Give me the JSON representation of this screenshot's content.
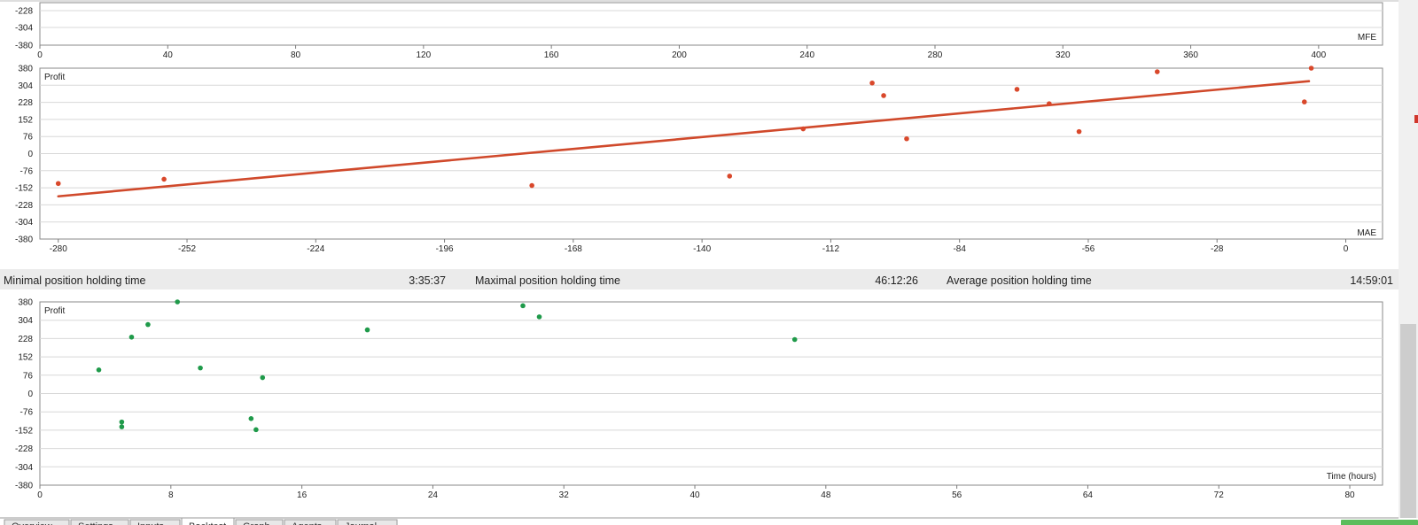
{
  "colors": {
    "mae_series": "#d9482b",
    "trend_line": "#d0492b",
    "time_series": "#1f9a4a",
    "grid": "#d8d8d8",
    "axis": "#7a7a7a",
    "stats_bar": "#ebebeb",
    "tab_active": "#ffffff",
    "tab_inactive": "#e8e8e8",
    "status_button": "#5cbd5c",
    "scroll_marker": "#d0362b"
  },
  "chart_data": [
    {
      "id": "mfe",
      "type": "scatter",
      "title": "",
      "ylabel": "",
      "xlabel": "MFE",
      "xlim": [
        0,
        420
      ],
      "x_ticks": [
        0,
        40,
        80,
        120,
        160,
        200,
        240,
        280,
        320,
        360,
        400
      ],
      "y_ticks_visible": [
        -228,
        -304,
        -380
      ],
      "points": []
    },
    {
      "id": "mae",
      "type": "scatter",
      "title": "",
      "ylabel": "Profit",
      "xlabel": "MAE",
      "xlim": [
        -284,
        8
      ],
      "ylim": [
        -380,
        380
      ],
      "x_ticks": [
        -280,
        -252,
        -224,
        -196,
        -168,
        -140,
        -112,
        -84,
        -56,
        -28,
        0
      ],
      "y_ticks": [
        380,
        304,
        228,
        152,
        76,
        0,
        -76,
        -152,
        -228,
        -304,
        -380
      ],
      "series": [
        {
          "name": "",
          "points": [
            {
              "x": -280,
              "y": -133
            },
            {
              "x": -257,
              "y": -114
            },
            {
              "x": -177,
              "y": -142
            },
            {
              "x": -134,
              "y": -100
            },
            {
              "x": -118,
              "y": 110
            },
            {
              "x": -103,
              "y": 314
            },
            {
              "x": -100.5,
              "y": 258
            },
            {
              "x": -95.5,
              "y": 66
            },
            {
              "x": -71.5,
              "y": 286
            },
            {
              "x": -64.5,
              "y": 222
            },
            {
              "x": -58,
              "y": 98
            },
            {
              "x": -41,
              "y": 364
            },
            {
              "x": -9,
              "y": 230
            },
            {
              "x": -7.5,
              "y": 380
            }
          ]
        }
      ],
      "trendline": {
        "x": [
          -280,
          -8
        ],
        "y": [
          -190,
          322
        ]
      }
    },
    {
      "id": "holding",
      "type": "scatter",
      "title": "",
      "ylabel": "Profit",
      "xlabel": "Time (hours)",
      "xlim": [
        0,
        82
      ],
      "ylim": [
        -380,
        380
      ],
      "x_ticks": [
        0,
        8,
        16,
        24,
        32,
        40,
        48,
        56,
        64,
        72,
        80
      ],
      "y_ticks": [
        380,
        304,
        228,
        152,
        76,
        0,
        -76,
        -152,
        -228,
        -304,
        -380
      ],
      "series": [
        {
          "name": "",
          "points": [
            {
              "x": 3.6,
              "y": 98
            },
            {
              "x": 5.0,
              "y": -118
            },
            {
              "x": 5.0,
              "y": -138
            },
            {
              "x": 5.6,
              "y": 234
            },
            {
              "x": 6.6,
              "y": 286
            },
            {
              "x": 8.4,
              "y": 380
            },
            {
              "x": 9.8,
              "y": 106
            },
            {
              "x": 12.9,
              "y": -104
            },
            {
              "x": 13.2,
              "y": -150
            },
            {
              "x": 13.6,
              "y": 66
            },
            {
              "x": 20.0,
              "y": 264
            },
            {
              "x": 29.5,
              "y": 364
            },
            {
              "x": 30.5,
              "y": 318
            },
            {
              "x": 46.1,
              "y": 224
            }
          ]
        }
      ]
    }
  ],
  "stats": {
    "min_label": "Minimal position holding time",
    "min_value": "3:35:37",
    "max_label": "Maximal position holding time",
    "max_value": "46:12:26",
    "avg_label": "Average position holding time",
    "avg_value": "14:59:01"
  },
  "tabs": [
    "Overview",
    "Settings",
    "Inputs",
    "Backtest",
    "Graph",
    "Agents",
    "Journal"
  ],
  "active_tab": "Backtest"
}
